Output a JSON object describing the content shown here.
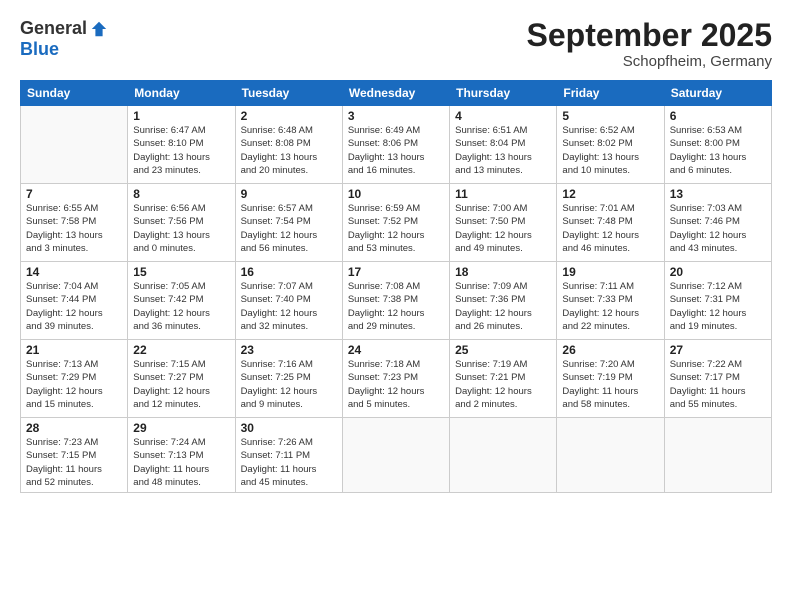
{
  "header": {
    "logo_general": "General",
    "logo_blue": "Blue",
    "month": "September 2025",
    "location": "Schopfheim, Germany"
  },
  "days_of_week": [
    "Sunday",
    "Monday",
    "Tuesday",
    "Wednesday",
    "Thursday",
    "Friday",
    "Saturday"
  ],
  "weeks": [
    [
      {
        "day": "",
        "info": ""
      },
      {
        "day": "1",
        "info": "Sunrise: 6:47 AM\nSunset: 8:10 PM\nDaylight: 13 hours\nand 23 minutes."
      },
      {
        "day": "2",
        "info": "Sunrise: 6:48 AM\nSunset: 8:08 PM\nDaylight: 13 hours\nand 20 minutes."
      },
      {
        "day": "3",
        "info": "Sunrise: 6:49 AM\nSunset: 8:06 PM\nDaylight: 13 hours\nand 16 minutes."
      },
      {
        "day": "4",
        "info": "Sunrise: 6:51 AM\nSunset: 8:04 PM\nDaylight: 13 hours\nand 13 minutes."
      },
      {
        "day": "5",
        "info": "Sunrise: 6:52 AM\nSunset: 8:02 PM\nDaylight: 13 hours\nand 10 minutes."
      },
      {
        "day": "6",
        "info": "Sunrise: 6:53 AM\nSunset: 8:00 PM\nDaylight: 13 hours\nand 6 minutes."
      }
    ],
    [
      {
        "day": "7",
        "info": "Sunrise: 6:55 AM\nSunset: 7:58 PM\nDaylight: 13 hours\nand 3 minutes."
      },
      {
        "day": "8",
        "info": "Sunrise: 6:56 AM\nSunset: 7:56 PM\nDaylight: 13 hours\nand 0 minutes."
      },
      {
        "day": "9",
        "info": "Sunrise: 6:57 AM\nSunset: 7:54 PM\nDaylight: 12 hours\nand 56 minutes."
      },
      {
        "day": "10",
        "info": "Sunrise: 6:59 AM\nSunset: 7:52 PM\nDaylight: 12 hours\nand 53 minutes."
      },
      {
        "day": "11",
        "info": "Sunrise: 7:00 AM\nSunset: 7:50 PM\nDaylight: 12 hours\nand 49 minutes."
      },
      {
        "day": "12",
        "info": "Sunrise: 7:01 AM\nSunset: 7:48 PM\nDaylight: 12 hours\nand 46 minutes."
      },
      {
        "day": "13",
        "info": "Sunrise: 7:03 AM\nSunset: 7:46 PM\nDaylight: 12 hours\nand 43 minutes."
      }
    ],
    [
      {
        "day": "14",
        "info": "Sunrise: 7:04 AM\nSunset: 7:44 PM\nDaylight: 12 hours\nand 39 minutes."
      },
      {
        "day": "15",
        "info": "Sunrise: 7:05 AM\nSunset: 7:42 PM\nDaylight: 12 hours\nand 36 minutes."
      },
      {
        "day": "16",
        "info": "Sunrise: 7:07 AM\nSunset: 7:40 PM\nDaylight: 12 hours\nand 32 minutes."
      },
      {
        "day": "17",
        "info": "Sunrise: 7:08 AM\nSunset: 7:38 PM\nDaylight: 12 hours\nand 29 minutes."
      },
      {
        "day": "18",
        "info": "Sunrise: 7:09 AM\nSunset: 7:36 PM\nDaylight: 12 hours\nand 26 minutes."
      },
      {
        "day": "19",
        "info": "Sunrise: 7:11 AM\nSunset: 7:33 PM\nDaylight: 12 hours\nand 22 minutes."
      },
      {
        "day": "20",
        "info": "Sunrise: 7:12 AM\nSunset: 7:31 PM\nDaylight: 12 hours\nand 19 minutes."
      }
    ],
    [
      {
        "day": "21",
        "info": "Sunrise: 7:13 AM\nSunset: 7:29 PM\nDaylight: 12 hours\nand 15 minutes."
      },
      {
        "day": "22",
        "info": "Sunrise: 7:15 AM\nSunset: 7:27 PM\nDaylight: 12 hours\nand 12 minutes."
      },
      {
        "day": "23",
        "info": "Sunrise: 7:16 AM\nSunset: 7:25 PM\nDaylight: 12 hours\nand 9 minutes."
      },
      {
        "day": "24",
        "info": "Sunrise: 7:18 AM\nSunset: 7:23 PM\nDaylight: 12 hours\nand 5 minutes."
      },
      {
        "day": "25",
        "info": "Sunrise: 7:19 AM\nSunset: 7:21 PM\nDaylight: 12 hours\nand 2 minutes."
      },
      {
        "day": "26",
        "info": "Sunrise: 7:20 AM\nSunset: 7:19 PM\nDaylight: 11 hours\nand 58 minutes."
      },
      {
        "day": "27",
        "info": "Sunrise: 7:22 AM\nSunset: 7:17 PM\nDaylight: 11 hours\nand 55 minutes."
      }
    ],
    [
      {
        "day": "28",
        "info": "Sunrise: 7:23 AM\nSunset: 7:15 PM\nDaylight: 11 hours\nand 52 minutes."
      },
      {
        "day": "29",
        "info": "Sunrise: 7:24 AM\nSunset: 7:13 PM\nDaylight: 11 hours\nand 48 minutes."
      },
      {
        "day": "30",
        "info": "Sunrise: 7:26 AM\nSunset: 7:11 PM\nDaylight: 11 hours\nand 45 minutes."
      },
      {
        "day": "",
        "info": ""
      },
      {
        "day": "",
        "info": ""
      },
      {
        "day": "",
        "info": ""
      },
      {
        "day": "",
        "info": ""
      }
    ]
  ]
}
